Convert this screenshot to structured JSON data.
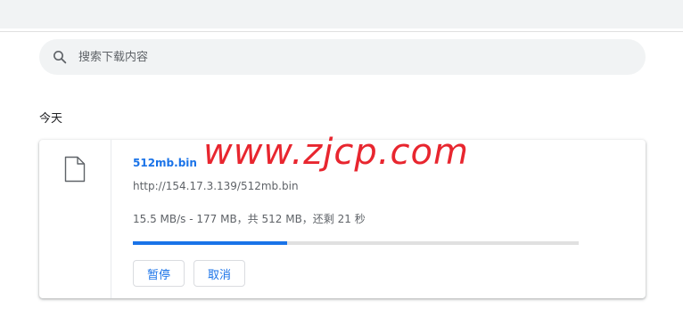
{
  "search": {
    "placeholder": "搜索下载内容",
    "value": ""
  },
  "section": {
    "title": "今天"
  },
  "download": {
    "file_name": "512mb.bin",
    "url": "http://154.17.3.139/512mb.bin",
    "status": "15.5 MB/s - 177 MB，共 512 MB，还剩 21 秒",
    "progress": 0.3457,
    "pause_label": "暂停",
    "cancel_label": "取消"
  },
  "watermark": {
    "text": "www.zjcp.com"
  },
  "colors": {
    "accent": "#1a73e8",
    "watermark": "#e8262f"
  },
  "icons": {
    "search": "search-icon",
    "file": "file-icon"
  }
}
